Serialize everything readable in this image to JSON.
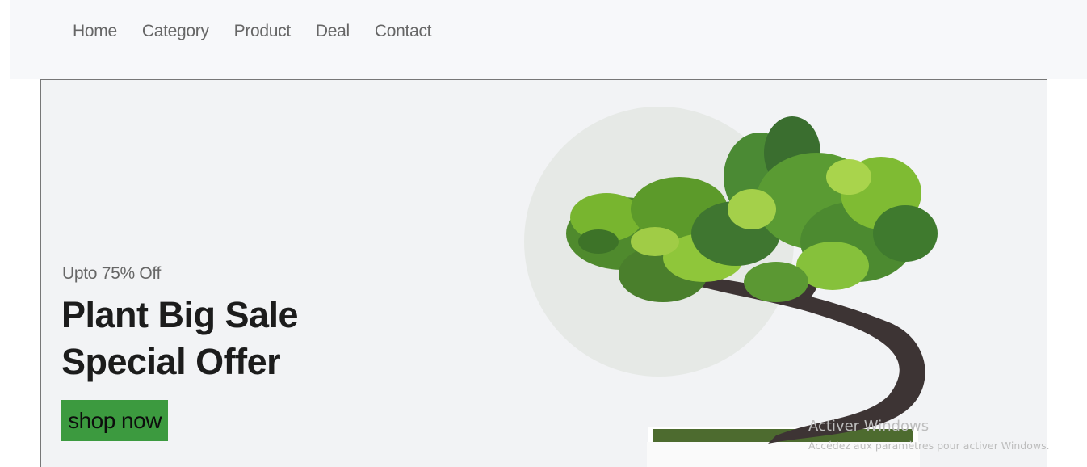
{
  "nav": {
    "links": [
      "Home",
      "Category",
      "Product",
      "Deal",
      "Contact"
    ]
  },
  "hero": {
    "subtitle": "Upto 75% Off",
    "title_line1": "Plant Big Sale",
    "title_line2": "Special Offer",
    "cta_label": "shop now",
    "image": "bonsai-tree-image"
  },
  "watermark": {
    "title": "Activer Windows",
    "subtitle": "Accédez aux paramètres pour activer Windows."
  },
  "colors": {
    "nav_bg": "#f7f8fa",
    "hero_bg": "#f2f3f5",
    "cta_bg": "#3c9a3f",
    "text_dark": "#1c1c1c",
    "text_muted": "#666666"
  }
}
